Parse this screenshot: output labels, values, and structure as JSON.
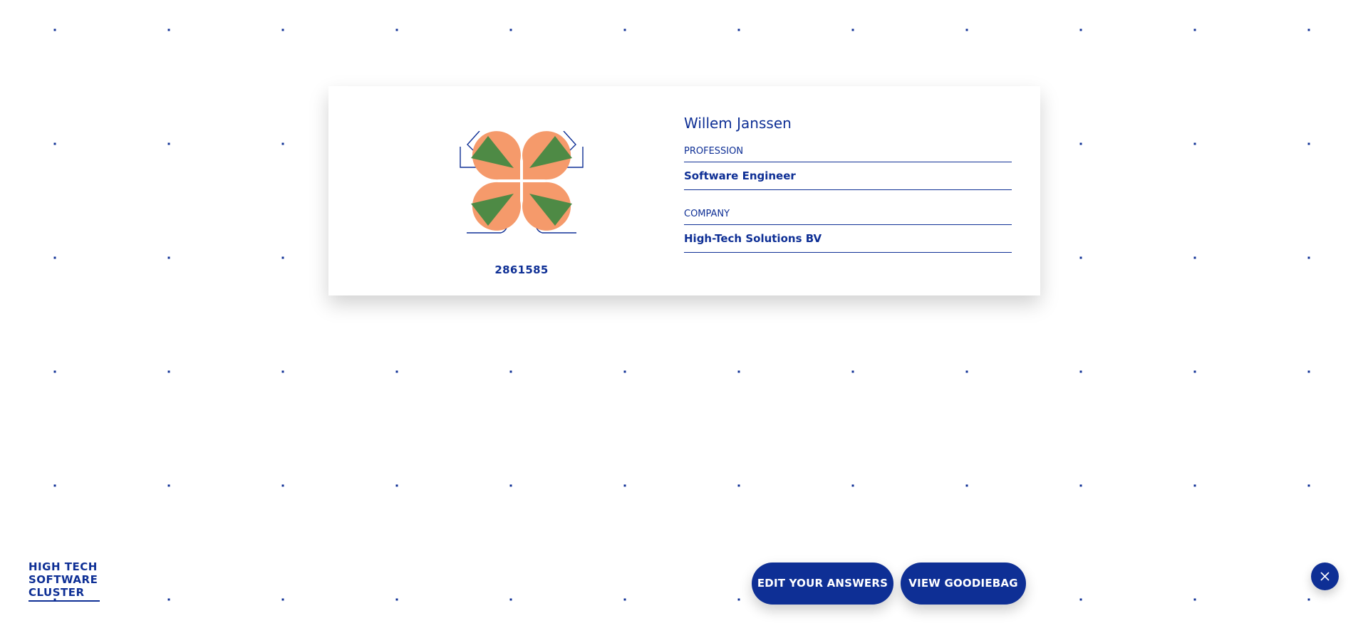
{
  "profile": {
    "name": "Willem Janssen",
    "badge_number": "2861585",
    "profession_label": "PROFESSION",
    "profession_value": "Software Engineer",
    "company_label": "COMPANY",
    "company_value": "High-Tech Solutions BV"
  },
  "logo": {
    "lines": [
      "HIGH TECH",
      "SOFTWARE",
      "CLUSTER"
    ]
  },
  "actions": {
    "edit_label": "EDIT YOUR ANSWERS",
    "goodiebag_label": "VIEW GOODIEBAG",
    "close_icon": "close-icon"
  },
  "colors": {
    "brand_blue": "#0e2f95",
    "petal_orange": "#f59a6b",
    "triangle_green": "#4e8a45",
    "background": "#ffffff"
  }
}
